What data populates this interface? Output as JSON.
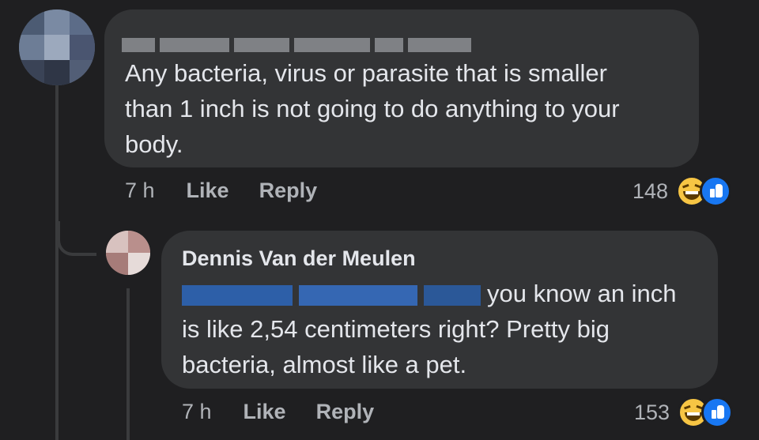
{
  "comment": {
    "text": "Any bacteria, virus or parasite that is smaller than 1 inch is not going to do anything to your body.",
    "line1": "Any bacteria, virus or parasite that is smaller",
    "line2": "than 1 inch is not going to do anything to your",
    "line3": "body.",
    "time": "7 h",
    "like_label": "Like",
    "reply_label": "Reply",
    "reaction_count": "148",
    "reaction_icons": [
      "haha-icon",
      "like-icon"
    ]
  },
  "reply": {
    "author": "Dennis Van der Meulen",
    "line1": "you know an inch",
    "line2": "is like 2,54 centimeters right? Pretty big",
    "line3": "bacteria, almost like a pet.",
    "time": "7 h",
    "like_label": "Like",
    "reply_label": "Reply",
    "reaction_count": "153",
    "reaction_icons": [
      "haha-icon",
      "like-icon"
    ]
  },
  "colors": {
    "background": "#1f1f21",
    "bubble": "#333436",
    "text": "#e4e6eb",
    "muted": "#b0b3b8",
    "like_blue": "#1877f2",
    "mention_blur": "#2d5fa8"
  }
}
